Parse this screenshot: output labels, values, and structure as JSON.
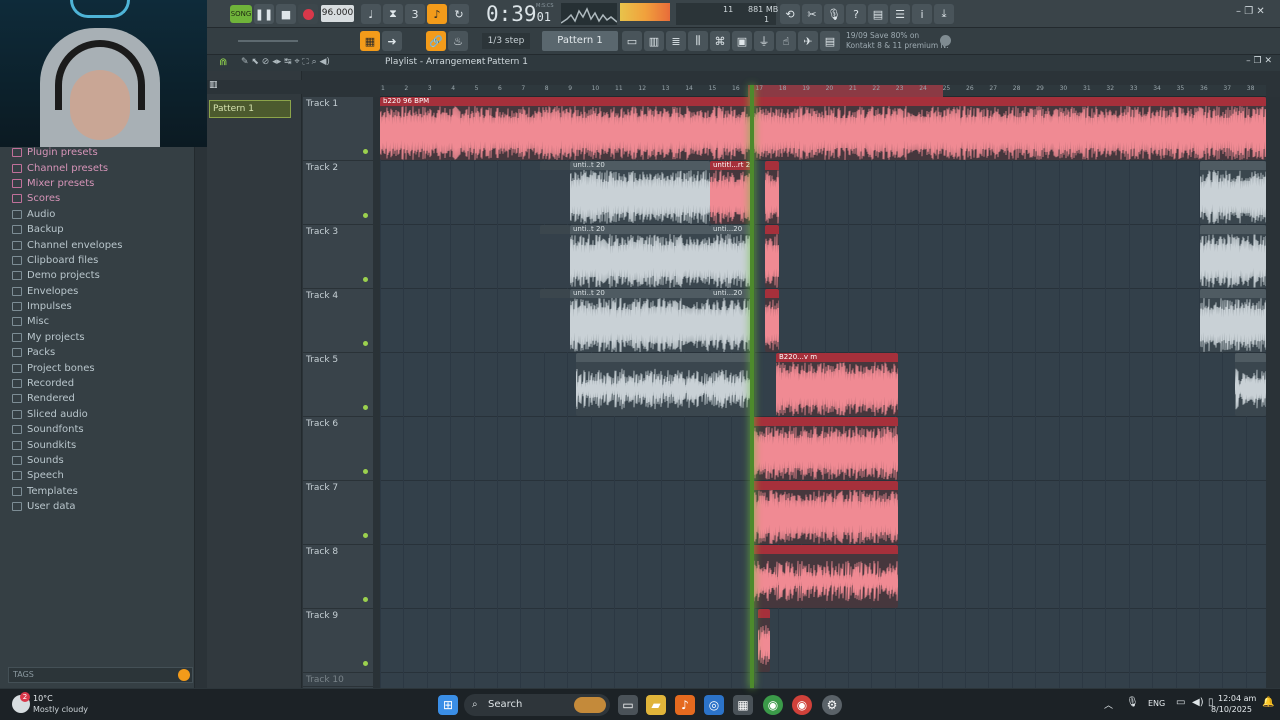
{
  "transport": {
    "song_label": "SONG",
    "tempo": "96.000",
    "time": "0:39",
    "time_frac": "01",
    "time_unit": "M:S:CS",
    "memory": "881 MB",
    "cpu_count": "11",
    "poly_count": "1"
  },
  "toolbar": {
    "step_label": "1/3 step",
    "pattern_label": "Pattern 1",
    "news_line1": "19/09  Save 80% on",
    "news_line2": "Kontakt 8 & 11 premium N."
  },
  "playlist": {
    "breadcrumb": "Playlist - Arrangement",
    "breadcrumb_sep": "›",
    "pattern_name": "Pattern 1",
    "bpm_clip_label": "b220 96 BPM",
    "tracks": [
      "Track 1",
      "Track 2",
      "Track 3",
      "Track 4",
      "Track 5",
      "Track 6",
      "Track 7",
      "Track 8",
      "Track 9",
      "Track 10"
    ],
    "ruler": [
      "1",
      "2",
      "3",
      "4",
      "5",
      "6",
      "7",
      "8",
      "9",
      "10",
      "11",
      "12",
      "13",
      "14",
      "15",
      "16",
      "17",
      "18",
      "19",
      "20",
      "21",
      "22",
      "23",
      "24",
      "25",
      "26",
      "27",
      "28",
      "29",
      "30",
      "31",
      "32",
      "33",
      "34",
      "35",
      "36",
      "37",
      "38"
    ],
    "clip_labels": {
      "untitled_20": "unti..t 20",
      "untitled_20b": "untitl...rt 20",
      "untitled_20c": "unti...20",
      "b220": "B220...v m"
    }
  },
  "browser": {
    "items": [
      {
        "label": "Plugin presets",
        "style": "pink"
      },
      {
        "label": "Channel presets",
        "style": "pink"
      },
      {
        "label": "Mixer presets",
        "style": "pink"
      },
      {
        "label": "Scores",
        "style": "pink"
      },
      {
        "label": "Audio",
        "style": "normal"
      },
      {
        "label": "Backup",
        "style": "normal"
      },
      {
        "label": "Channel envelopes",
        "style": "normal"
      },
      {
        "label": "Clipboard files",
        "style": "normal"
      },
      {
        "label": "Demo projects",
        "style": "normal"
      },
      {
        "label": "Envelopes",
        "style": "normal"
      },
      {
        "label": "Impulses",
        "style": "normal"
      },
      {
        "label": "Misc",
        "style": "normal"
      },
      {
        "label": "My projects",
        "style": "normal"
      },
      {
        "label": "Packs",
        "style": "normal"
      },
      {
        "label": "Project bones",
        "style": "normal"
      },
      {
        "label": "Recorded",
        "style": "normal"
      },
      {
        "label": "Rendered",
        "style": "normal"
      },
      {
        "label": "Sliced audio",
        "style": "normal"
      },
      {
        "label": "Soundfonts",
        "style": "normal"
      },
      {
        "label": "Soundkits",
        "style": "normal"
      },
      {
        "label": "Sounds",
        "style": "normal"
      },
      {
        "label": "Speech",
        "style": "normal"
      },
      {
        "label": "Templates",
        "style": "normal"
      },
      {
        "label": "User data",
        "style": "normal"
      }
    ],
    "tags_label": "TAGS"
  },
  "taskbar": {
    "weather_temp": "10°C",
    "weather_desc": "Mostly cloudy",
    "search_label": "Search",
    "lang": "ENG",
    "time": "12:04 am",
    "date": "8/10/2025",
    "badge": "2"
  },
  "colors": {
    "accent_orange": "#f39b1a",
    "clip_red": "#f08a93",
    "playhead_green": "#6fc03a",
    "waveform_grey": "#c9d1d6"
  }
}
